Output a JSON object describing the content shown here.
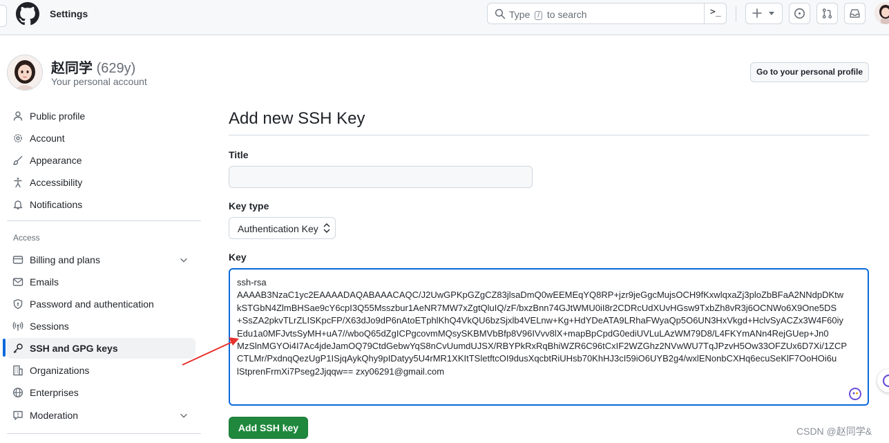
{
  "header": {
    "title": "Settings",
    "search": {
      "prefix": "Type",
      "key": "/",
      "suffix": "to search"
    }
  },
  "profile": {
    "name": "赵同学",
    "count": "(629y)",
    "subtitle": "Your personal account",
    "profile_button": "Go to your personal profile"
  },
  "sidebar": {
    "items": [
      {
        "label": "Public profile",
        "icon": "person-icon"
      },
      {
        "label": "Account",
        "icon": "gear-icon"
      },
      {
        "label": "Appearance",
        "icon": "paintbrush-icon"
      },
      {
        "label": "Accessibility",
        "icon": "accessibility-icon"
      },
      {
        "label": "Notifications",
        "icon": "bell-icon"
      }
    ],
    "access_heading": "Access",
    "access_items": [
      {
        "label": "Billing and plans",
        "icon": "credit-card-icon",
        "expandable": true
      },
      {
        "label": "Emails",
        "icon": "mail-icon"
      },
      {
        "label": "Password and authentication",
        "icon": "shield-lock-icon"
      },
      {
        "label": "Sessions",
        "icon": "broadcast-icon"
      },
      {
        "label": "SSH and GPG keys",
        "icon": "key-icon",
        "active": true
      },
      {
        "label": "Organizations",
        "icon": "organization-icon"
      },
      {
        "label": "Enterprises",
        "icon": "globe-icon"
      },
      {
        "label": "Moderation",
        "icon": "report-icon",
        "expandable": true
      }
    ]
  },
  "main": {
    "heading": "Add new SSH Key",
    "title_label": "Title",
    "title_value": "",
    "key_type_label": "Key type",
    "key_type_value": "Authentication Key",
    "key_label": "Key",
    "key_lines": [
      "ssh-rsa",
      "AAAAB3NzaC1yc2EAAAADAQABAAACAQC/J2UwGPKpGZgCZ83jlsaDmQ0wEEMEqYQ8RP+jzr9jeGgcMujsOCH9fKxwlqxaZj3ploZbBFaA2NNdpDKtw",
      "kSTGbN4ZlmBHSae9cY6cpI3Q55Msszbur1AeNR7MW7xZgtQluIQ/zF/bxzBnn74GJtWMU0iI8r2CDRcUdXUvHGsw9TxbZh8vR3j6OCNWo6X9One5DS",
      "+SsZA2pkvTLrZLISKpcFP/X63dJo9dP6nAtoETphlKhQ4VkQU6bzSjxlb4VELnw+Kg+HdYDeATA9LRhaFWyaQp5O6UN3HxVkgd+HclvSyACZx3W4F60iy",
      "Edu1a0MFJvtsSyMH+uA7//wboQ65dZgICPgcovmMQsySKBMVbBfp8V96IVvv8lX+mapBpCpdG0ediUVLuLAzWM79D8/L4FKYmANn4RejGUep+Jn0",
      "MzSlnMGYOi4I7Ac4jdeJamOQ79CtdGebwYqS8nCvUumdUJSX/RBYPkRxRqBhiWZR6C96tCxIF2WZGhz2NVwWU7TqJPzvH5Ow33OFZUx6D7Xi/1ZCP",
      "CTLMr/PxdnqQezUgP1ISjqAykQhy9pIDatyy5U4rMR1XKItTSletftcOI9dusXqcbtRiUHsb70KhHJ3cI59iO6UYB2g4/wxlENonbCXHq6ecuSeKlF7OoHOi6u",
      "lStprenFrmXi7Pseg2Jjqqw== zxy06291@gmail.com"
    ],
    "submit_label": "Add SSH key"
  },
  "watermark": "CSDN @赵同学&",
  "colors": {
    "accent": "#0969da",
    "primary_button": "#1f883d",
    "annotation_arrow": "#e8322e"
  }
}
